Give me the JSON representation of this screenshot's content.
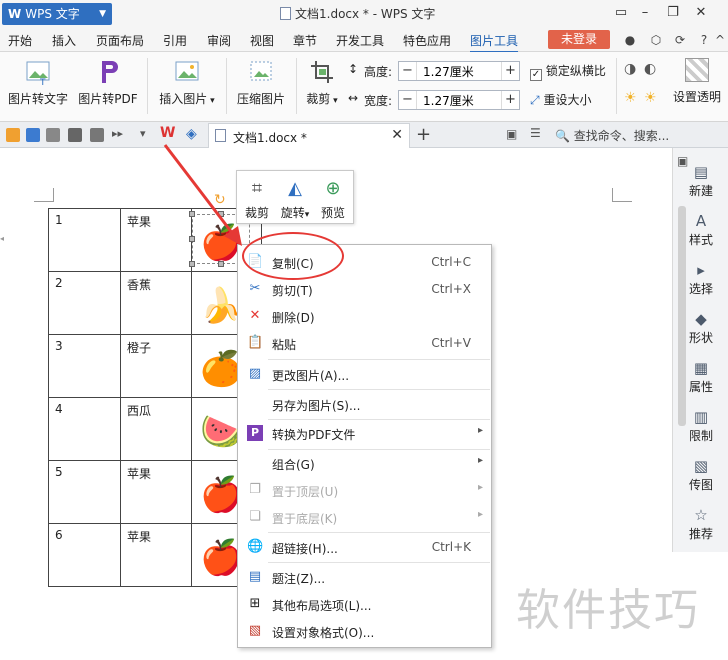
{
  "titlebar": {
    "app_name": "WPS 文字",
    "doc_title": "文档1.docx * - WPS 文字"
  },
  "menubar": {
    "items": [
      "开始",
      "插入",
      "页面布局",
      "引用",
      "审阅",
      "视图",
      "章节",
      "开发工具",
      "特色应用",
      "图片工具"
    ],
    "active": "图片工具",
    "login": "未登录"
  },
  "ribbon": {
    "pic_to_text": "图片转文字",
    "pic_to_pdf": "图片转PDF",
    "insert_pic": "插入图片",
    "compress": "压缩图片",
    "crop": "裁剪",
    "height_label": "高度:",
    "height_value": "1.27厘米",
    "width_label": "宽度:",
    "width_value": "1.27厘米",
    "lock_ratio": "锁定纵横比",
    "reset_size": "重设大小",
    "set_transparent": "设置透明"
  },
  "tabs": {
    "doc_tab": "文档1.docx *",
    "search_placeholder": "查找命令、搜索..."
  },
  "table": {
    "rows": [
      {
        "num": "1",
        "name": "苹果",
        "emoji": "🍎"
      },
      {
        "num": "2",
        "name": "香蕉",
        "emoji": "🍌"
      },
      {
        "num": "3",
        "name": "橙子",
        "emoji": "🍊"
      },
      {
        "num": "4",
        "name": "西瓜",
        "emoji": "🍉"
      },
      {
        "num": "5",
        "name": "苹果",
        "emoji": "🍎"
      },
      {
        "num": "6",
        "name": "苹果",
        "emoji": "🍎"
      }
    ]
  },
  "mini_toolbar": {
    "crop": "裁剪",
    "rotate": "旋转",
    "preview": "预览"
  },
  "context_menu": {
    "copy": {
      "label": "复制(C)",
      "shortcut": "Ctrl+C"
    },
    "cut": {
      "label": "剪切(T)",
      "shortcut": "Ctrl+X"
    },
    "delete": {
      "label": "删除(D)"
    },
    "paste": {
      "label": "粘贴",
      "shortcut": "Ctrl+V"
    },
    "change_pic": {
      "label": "更改图片(A)..."
    },
    "save_as_pic": {
      "label": "另存为图片(S)..."
    },
    "to_pdf": {
      "label": "转换为PDF文件"
    },
    "group": {
      "label": "组合(G)"
    },
    "bring_top": {
      "label": "置于顶层(U)"
    },
    "send_bottom": {
      "label": "置于底层(K)"
    },
    "hyperlink": {
      "label": "超链接(H)...",
      "shortcut": "Ctrl+K"
    },
    "caption": {
      "label": "题注(Z)..."
    },
    "layout_options": {
      "label": "其他布局选项(L)..."
    },
    "format_object": {
      "label": "设置对象格式(O)..."
    }
  },
  "right_panel": [
    "新建",
    "样式",
    "选择",
    "形状",
    "属性",
    "限制",
    "传图",
    "推荐"
  ],
  "watermark": "软件技巧",
  "colors": {
    "accent": "#2f6fc0",
    "login": "#e2634a",
    "callout": "#e53935"
  }
}
